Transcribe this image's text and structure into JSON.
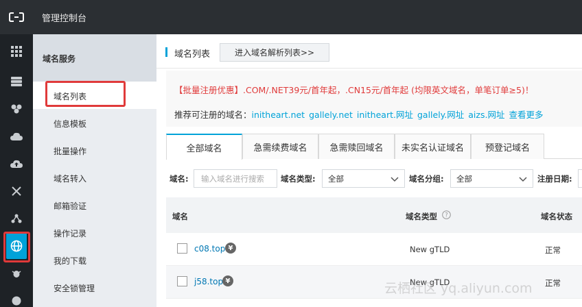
{
  "topbar": {
    "title": "管理控制台"
  },
  "subnav": {
    "header": "域名服务",
    "items": [
      {
        "label": "域名列表",
        "active": true
      },
      {
        "label": "信息模板"
      },
      {
        "label": "批量操作"
      },
      {
        "label": "域名转入"
      },
      {
        "label": "邮箱验证"
      },
      {
        "label": "操作记录"
      },
      {
        "label": "我的下载"
      },
      {
        "label": "安全锁管理"
      }
    ]
  },
  "main": {
    "title": "域名列表",
    "dns_button": "进入域名解析列表>>",
    "promo": {
      "line1": "【批量注册优惠】.COM/.NET39元/首年起，.CN15元/首年起 (均限英文域名，单笔订单≥5)！",
      "label": "推荐可注册的域名：",
      "domains": [
        "initheart.net",
        "gallely.net",
        "initheart.网址",
        "gallely.网址",
        "aizs.网址",
        "查看更多"
      ]
    },
    "tabs": [
      "全部域名",
      "急需续费域名",
      "急需赎回域名",
      "未实名认证域名",
      "预登记域名"
    ],
    "filters": {
      "domain_label": "域名:",
      "domain_placeholder": "输入域名进行搜索",
      "type_label": "域名类型:",
      "type_value": "全部",
      "group_label": "域名分组:",
      "group_value": "全部",
      "date_label": "注册日期:"
    },
    "table": {
      "headers": [
        "域名",
        "域名类型",
        "域名状态"
      ],
      "rows": [
        {
          "domain": "c08.top",
          "type": "New gTLD",
          "status": "正常"
        },
        {
          "domain": "j58.top",
          "type": "New gTLD",
          "status": "正常"
        }
      ]
    }
  },
  "watermark": "云栖社区 yq.aliyun.com",
  "colors": {
    "accent": "#00a2d8",
    "promo_red": "#e03a3a",
    "topbar": "#2b2f33",
    "rail": "#1e2226"
  }
}
